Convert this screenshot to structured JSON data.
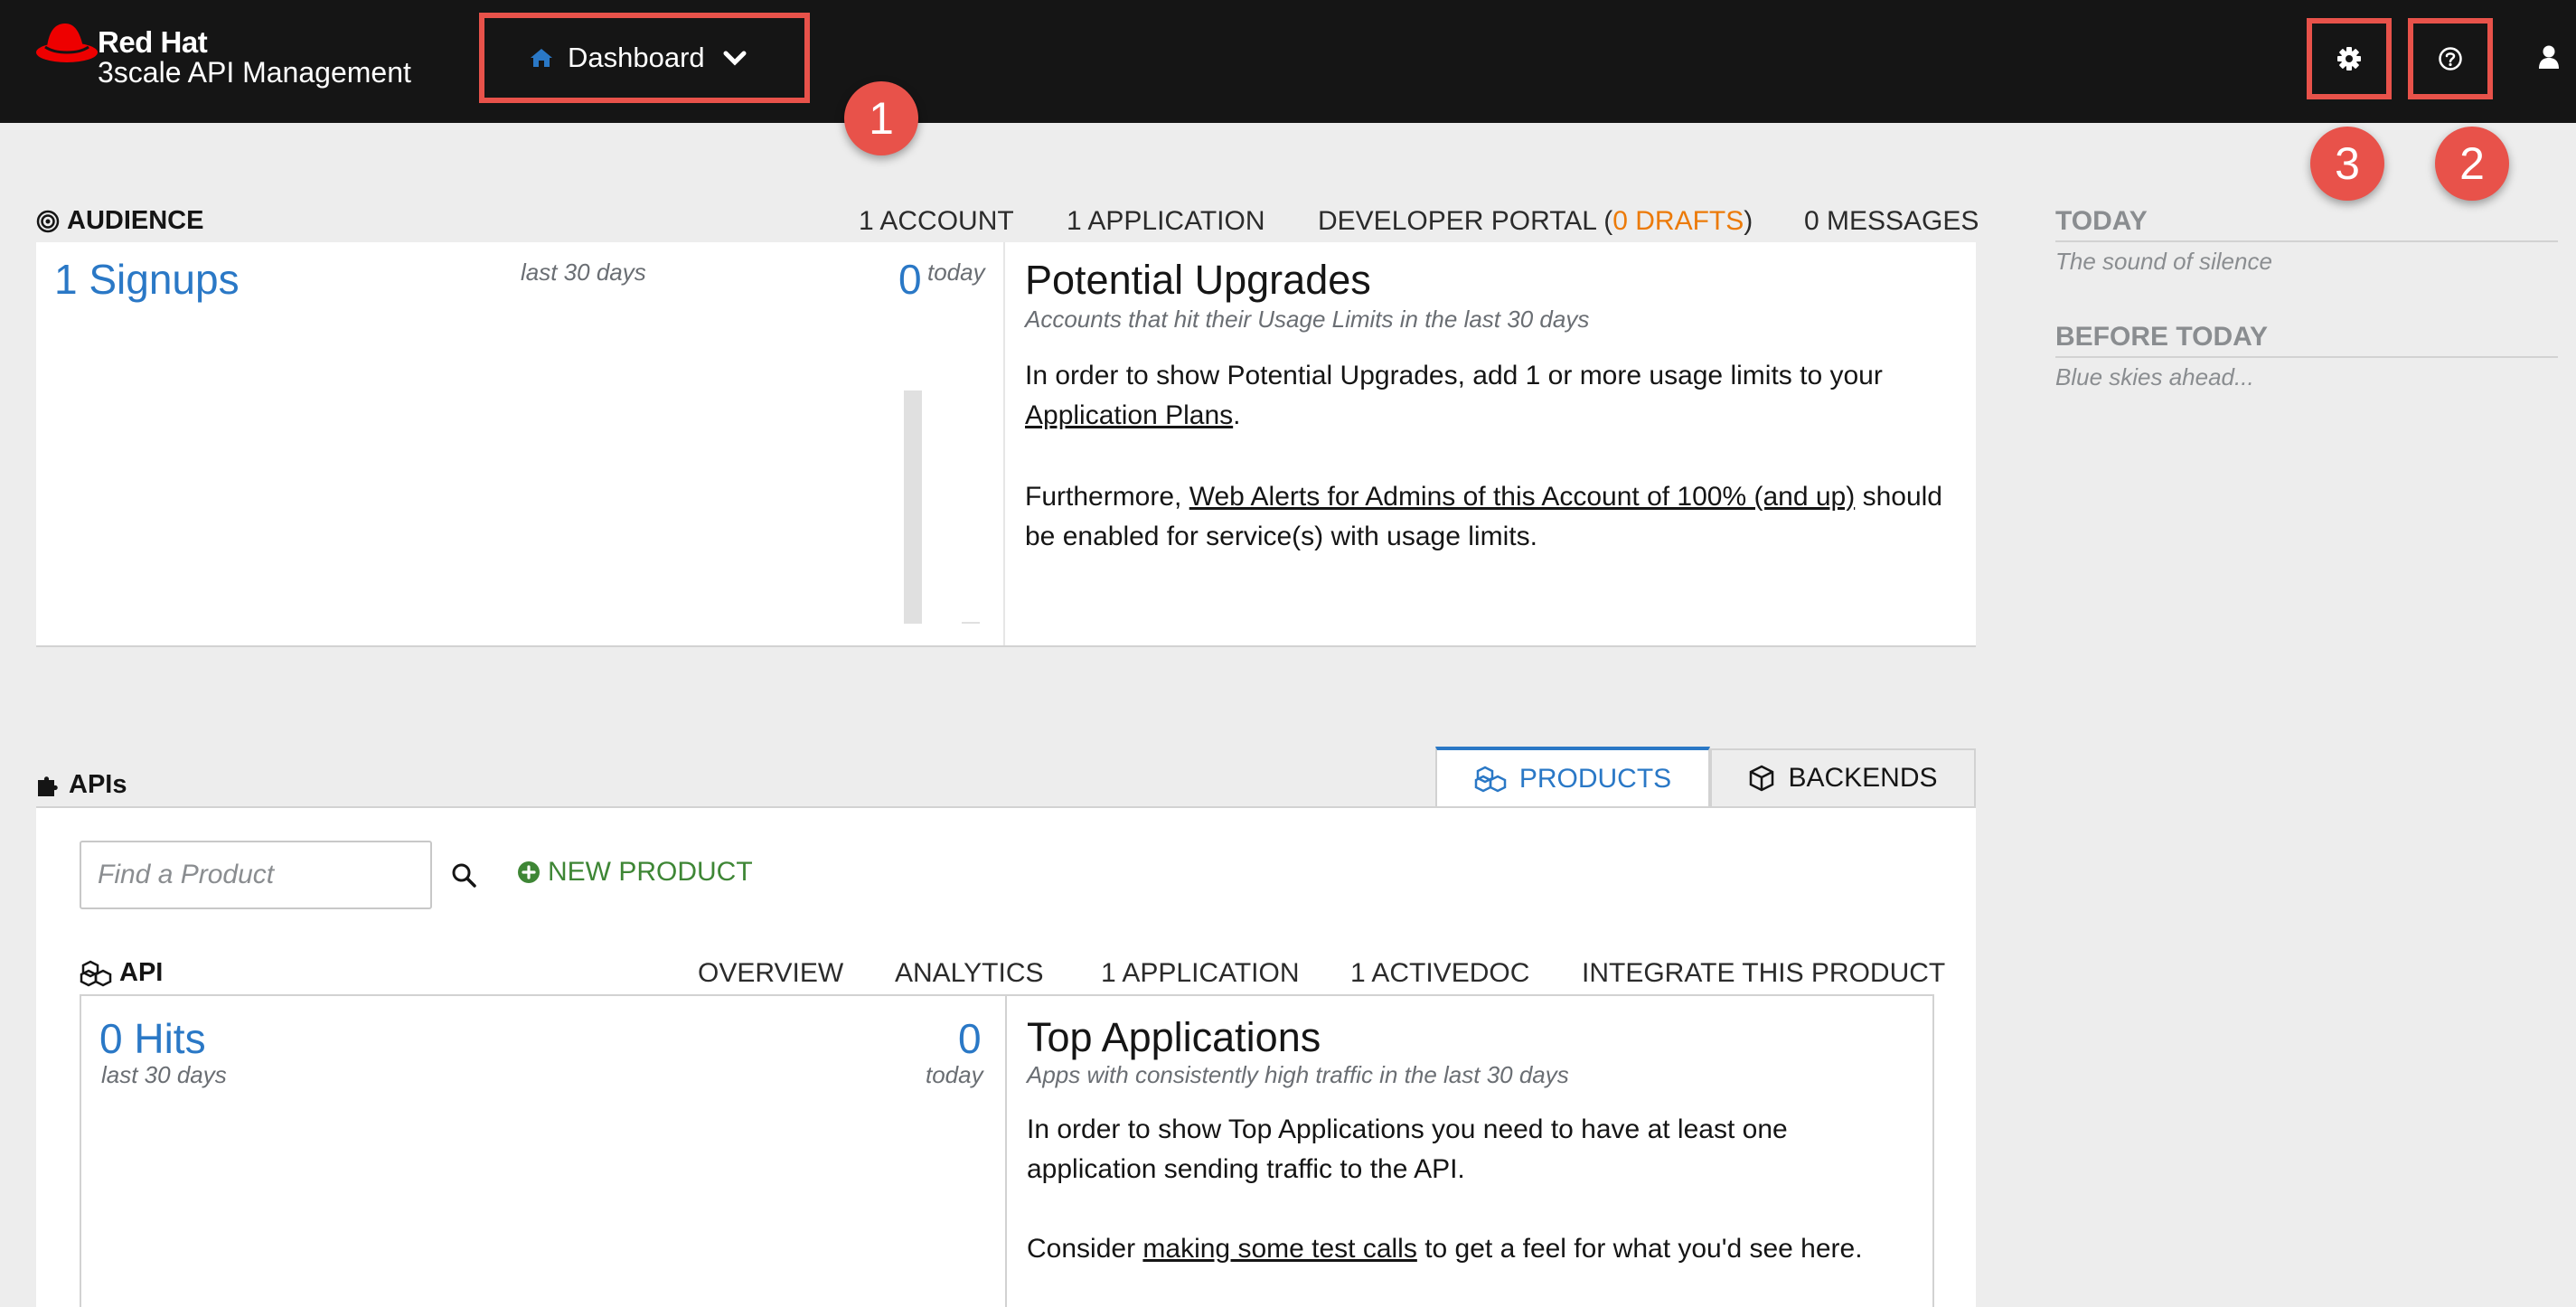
{
  "brand": {
    "line1": "Red Hat",
    "line2": "3scale API Management",
    "accent": "#ee0000"
  },
  "header": {
    "context_selector": {
      "label": "Dashboard",
      "icon": "home-icon",
      "chevron": "chevron-down-icon"
    },
    "icons": [
      "gear-icon",
      "help-icon",
      "user-icon"
    ],
    "callouts": [
      "1",
      "2",
      "3"
    ]
  },
  "audience": {
    "title": "AUDIENCE",
    "nav": {
      "accounts": "1 ACCOUNT",
      "applications": "1 APPLICATION",
      "portal_prefix": "DEVELOPER PORTAL (",
      "portal_drafts": "0 DRAFTS",
      "portal_suffix": ")",
      "messages": "0 MESSAGES"
    },
    "signups": {
      "label": "1 Signups",
      "period": "last 30 days",
      "today_value": "0",
      "today_label": "today",
      "spark_level": 1
    },
    "upgrades": {
      "title": "Potential Upgrades",
      "subtitle": "Accounts that hit their Usage Limits in the last 30 days",
      "para1_text": "In order to show Potential Upgrades, add 1 or more usage limits to your ",
      "para1_link": "Application Plans",
      "para1_end": ".",
      "para2_start": "Furthermore, ",
      "para2_link": "Web Alerts for Admins of this Account of 100% (and up)",
      "para2_end": " should be enabled for service(s) with usage limits."
    }
  },
  "sidebar": {
    "today": {
      "title": "TODAY",
      "note": "The sound of silence"
    },
    "before": {
      "title": "BEFORE TODAY",
      "note": "Blue skies ahead..."
    }
  },
  "apis": {
    "title": "APIs",
    "tabs": [
      {
        "label": "PRODUCTS",
        "active": true
      },
      {
        "label": "BACKENDS",
        "active": false
      }
    ],
    "search": {
      "placeholder": "Find a Product",
      "value": ""
    },
    "new_product": "NEW PRODUCT",
    "api": {
      "name": "API",
      "nav": {
        "overview": "OVERVIEW",
        "analytics": "ANALYTICS",
        "applications": "1 APPLICATION",
        "activedocs": "1 ACTIVEDOC",
        "integrate": "INTEGRATE THIS PRODUCT"
      },
      "hits": {
        "label": "0 Hits",
        "period": "last 30 days",
        "today_value": "0",
        "today_label": "today"
      },
      "top_apps": {
        "title": "Top Applications",
        "subtitle": "Apps with consistently high traffic in the last 30 days",
        "para1": "In order to show Top Applications you need to have at least one application sending traffic to the API.",
        "para2_start": "Consider ",
        "para2_link": "making some test calls",
        "para2_end": " to get a feel for what you'd see here."
      }
    }
  },
  "colors": {
    "topbar": "#151515",
    "highlight": "#e8524a",
    "link_blue": "#2a78c6",
    "orange": "#ec7a08",
    "green": "#3e8635"
  }
}
